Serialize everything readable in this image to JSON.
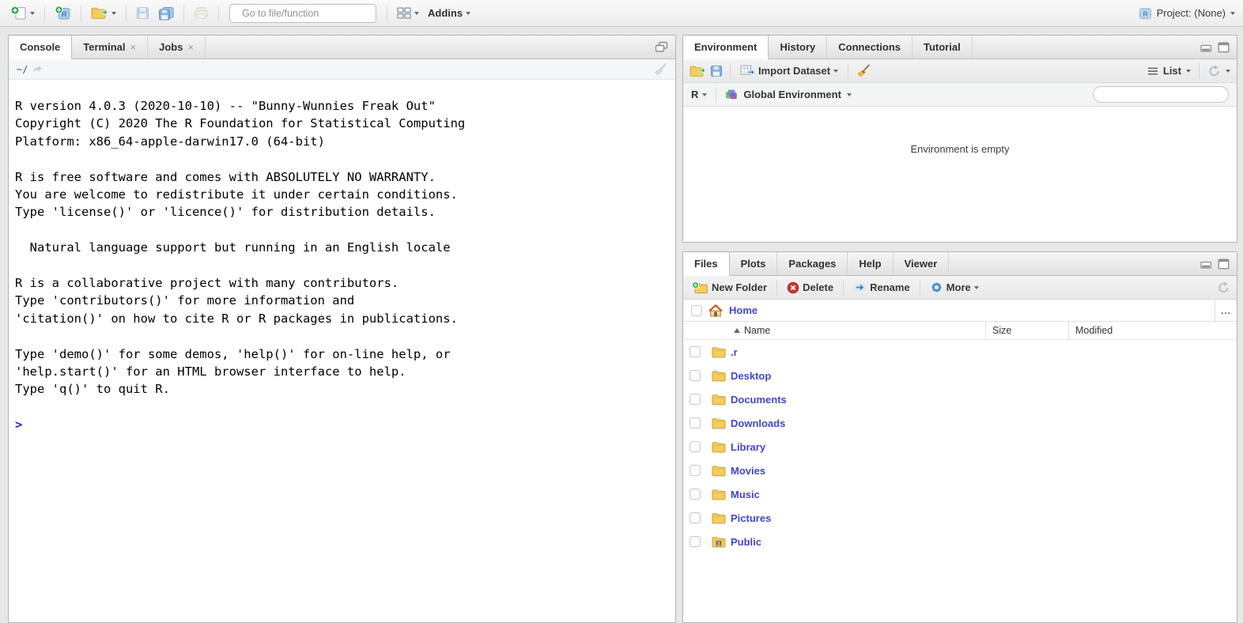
{
  "main_toolbar": {
    "goto": {
      "placeholder": "Go to file/function",
      "icon": "goto-arrow-icon"
    },
    "addins": {
      "label": "Addins",
      "icon": "caret-down-icon"
    },
    "project": {
      "label": "Project: (None)",
      "icon": "r-project-cube-icon"
    },
    "icons": [
      "new-file-icon",
      "new-project-icon",
      "open-file-icon",
      "save-icon",
      "save-all-icon",
      "print-icon",
      "panes-layout-icon"
    ]
  },
  "console_pane": {
    "tabs": [
      {
        "label": "Console",
        "active": true
      },
      {
        "label": "Terminal",
        "closable": true
      },
      {
        "label": "Jobs",
        "closable": true
      }
    ],
    "close_symbol": "×",
    "working_directory": "~/",
    "icons": [
      "goto-directory-icon",
      "restore-panes-icon",
      "clear-console-broom-icon"
    ],
    "output_lines": [
      "R version 4.0.3 (2020-10-10) -- \"Bunny-Wunnies Freak Out\"",
      "Copyright (C) 2020 The R Foundation for Statistical Computing",
      "Platform: x86_64-apple-darwin17.0 (64-bit)",
      "",
      "R is free software and comes with ABSOLUTELY NO WARRANTY.",
      "You are welcome to redistribute it under certain conditions.",
      "Type 'license()' or 'licence()' for distribution details.",
      "",
      "  Natural language support but running in an English locale",
      "",
      "R is a collaborative project with many contributors.",
      "Type 'contributors()' for more information and",
      "'citation()' on how to cite R or R packages in publications.",
      "",
      "Type 'demo()' for some demos, 'help()' for on-line help, or",
      "'help.start()' for an HTML browser interface to help.",
      "Type 'q()' to quit R.",
      ""
    ],
    "prompt": ">"
  },
  "environment_pane": {
    "tabs": [
      "Environment",
      "History",
      "Connections",
      "Tutorial"
    ],
    "toolbar": {
      "import_dataset": "Import Dataset",
      "list_mode": "List"
    },
    "icons": [
      "open-environment-icon",
      "save-workspace-icon",
      "import-dataset-icon",
      "clear-environment-broom-icon",
      "list-view-icon",
      "refresh-icon",
      "minimize-icon",
      "maximize-icon",
      "search-icon"
    ],
    "selectors": {
      "language": "R",
      "scope": "Global Environment"
    },
    "search": {
      "value": ""
    },
    "empty_message": "Environment is empty"
  },
  "files_pane": {
    "tabs": [
      "Files",
      "Plots",
      "Packages",
      "Help",
      "Viewer"
    ],
    "toolbar": {
      "new_folder": "New Folder",
      "delete": "Delete",
      "rename": "Rename",
      "more": "More"
    },
    "icons": [
      "new-folder-icon",
      "delete-icon",
      "rename-icon",
      "more-gear-icon",
      "refresh-icon",
      "home-icon",
      "minimize-icon",
      "maximize-icon"
    ],
    "breadcrumb": {
      "home": "Home",
      "more": "..."
    },
    "columns": [
      {
        "label": "Name",
        "sorted": "asc"
      },
      {
        "label": "Size"
      },
      {
        "label": "Modified"
      }
    ],
    "rows": [
      {
        "name": ".r",
        "type": "folder"
      },
      {
        "name": "Desktop",
        "type": "folder"
      },
      {
        "name": "Documents",
        "type": "folder"
      },
      {
        "name": "Downloads",
        "type": "folder"
      },
      {
        "name": "Library",
        "type": "folder"
      },
      {
        "name": "Movies",
        "type": "folder"
      },
      {
        "name": "Music",
        "type": "folder"
      },
      {
        "name": "Pictures",
        "type": "folder"
      },
      {
        "name": "Public",
        "type": "public-folder"
      }
    ]
  },
  "colors": {
    "link_blue": "#4444C8",
    "prompt_blue": "#2525CC",
    "folder_yellow": "#F5CD5C",
    "delete_red": "#D0342C",
    "toolbar_gray": "#ECECEC",
    "pane_border": "#B2B2B2"
  }
}
